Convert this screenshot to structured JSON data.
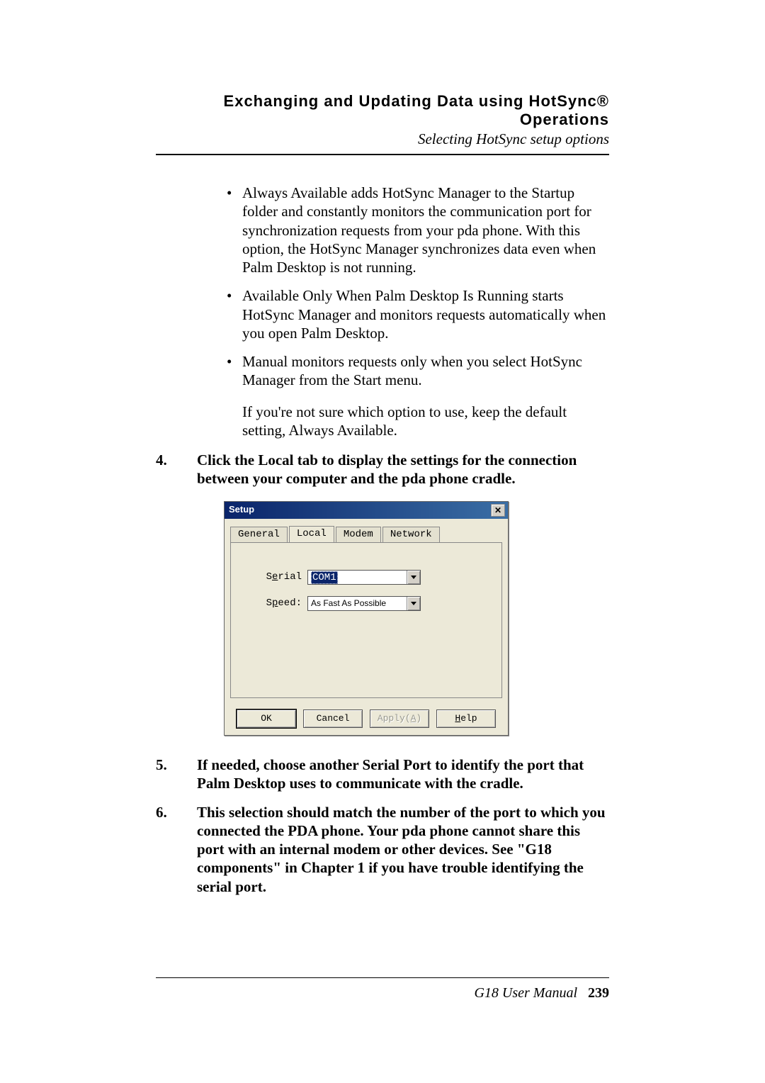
{
  "header": {
    "title": "Exchanging and Updating Data using HotSync® Operations",
    "subtitle": "Selecting HotSync setup options"
  },
  "bullets": [
    "Always Available adds HotSync Manager to the Startup folder and constantly monitors the communication port for synchronization requests from your pda phone. With this option, the HotSync Manager synchronizes data even when Palm Desktop is not running.",
    "Available Only When Palm Desktop Is Running starts HotSync Manager and monitors requests automatically when you open Palm Desktop.",
    "Manual monitors requests only when you select HotSync Manager from the Start menu."
  ],
  "after_bullets": "If you're not sure which option to use, keep the default setting, Always Available.",
  "steps": {
    "s4": {
      "num": "4.",
      "text": "Click the Local tab to display the settings for the connection between your computer and the pda phone cradle."
    },
    "s5": {
      "num": "5.",
      "text": "If needed, choose another Serial Port to identify the port that Palm Desktop uses to communicate with the cradle."
    },
    "s6": {
      "num": "6.",
      "text": "This selection should match the number of the port to which you connected the PDA phone. Your pda phone cannot share this port with an internal modem or other devices. See \"G18 components\" in Chapter 1 if you have trouble identifying the serial port."
    }
  },
  "dialog": {
    "title": "Setup",
    "tabs": [
      "General",
      "Local",
      "Modem",
      "Network"
    ],
    "active_tab_index": 1,
    "fields": {
      "serial": {
        "label_pre": "S",
        "label_ul": "e",
        "label_post": "rial",
        "value": "COM1"
      },
      "speed": {
        "label_pre": "S",
        "label_ul": "p",
        "label_post": "eed:",
        "value": "As Fast As Possible"
      }
    },
    "buttons": {
      "ok": "OK",
      "cancel": "Cancel",
      "apply_pre": "Apply(",
      "apply_ul": "A",
      "apply_post": ")",
      "help_ul": "H",
      "help_post": "elp"
    }
  },
  "footer": {
    "manual": "G18 User Manual",
    "page": "239"
  }
}
